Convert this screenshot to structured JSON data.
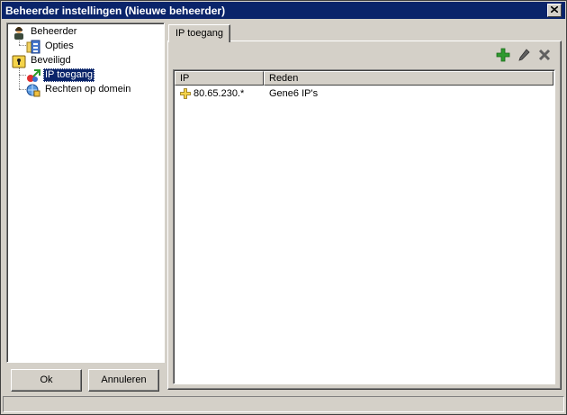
{
  "window": {
    "title": "Beheerder instellingen (Nieuwe beheerder)"
  },
  "tree": {
    "items": [
      {
        "label": "Beheerder",
        "icon": "user-icon"
      },
      {
        "label": "Opties",
        "icon": "options-icon"
      },
      {
        "label": "Beveiligd",
        "icon": "lock-icon"
      },
      {
        "label": "IP toegang",
        "icon": "ip-access-icon",
        "selected": true
      },
      {
        "label": "Rechten op domein",
        "icon": "domain-rights-icon"
      }
    ]
  },
  "buttons": {
    "ok": "Ok",
    "cancel": "Annuleren"
  },
  "tabs": [
    {
      "label": "IP toegang"
    }
  ],
  "toolbar": {
    "add": "add-icon",
    "edit": "edit-icon",
    "delete": "delete-icon"
  },
  "list": {
    "columns": [
      "IP",
      "Reden"
    ],
    "rows": [
      {
        "ip": "80.65.230.*",
        "reason": "Gene6 IP's"
      }
    ]
  },
  "colors": {
    "titlebar": "#0a246a",
    "selection": "#0a246a",
    "face": "#d4d0c8"
  }
}
